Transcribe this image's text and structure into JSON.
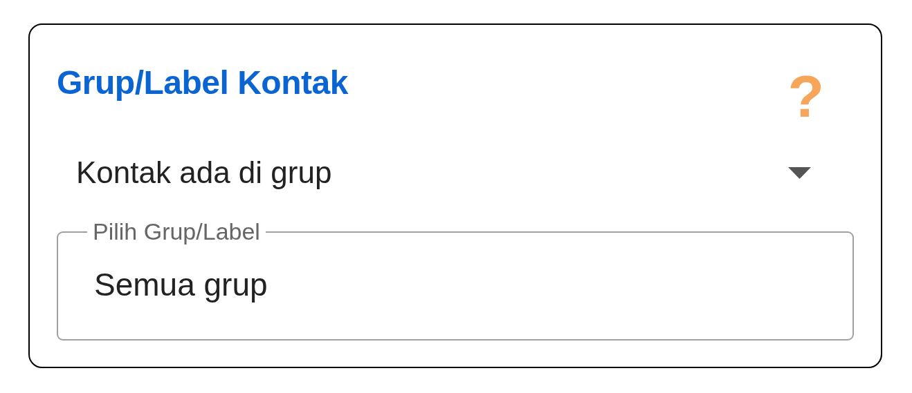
{
  "card": {
    "title": "Grup/Label Kontak",
    "help_icon": "?"
  },
  "condition_select": {
    "value": "Kontak ada di grup"
  },
  "group_field": {
    "label": "Pilih Grup/Label",
    "value": "Semua grup"
  }
}
